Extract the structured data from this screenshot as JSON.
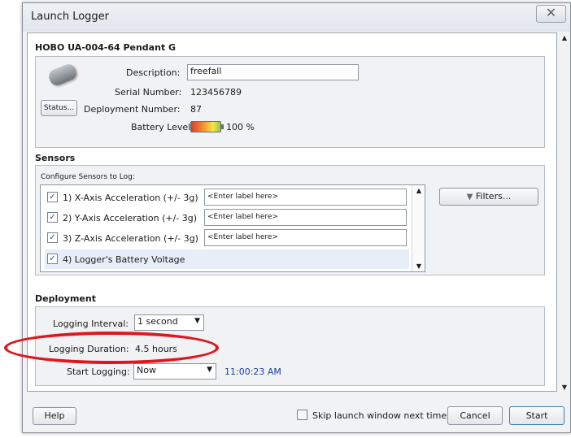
{
  "window": {
    "title": "Launch Logger",
    "close_glyph": "✕"
  },
  "device": {
    "name": "HOBO UA-004-64 Pendant G",
    "description_label": "Description:",
    "description_value": "freefall",
    "serial_label": "Serial Number:",
    "serial_value": "123456789",
    "deployment_label": "Deployment Number:",
    "deployment_value": "87",
    "battery_label": "Battery Level:",
    "battery_value": "100 %",
    "battery_level": 1.0,
    "status_button": "Status..."
  },
  "sensors": {
    "heading": "Sensors",
    "configure_label": "Configure Sensors to Log:",
    "filters_button": "Filters...",
    "items": [
      {
        "label": "1)  X-Axis Acceleration (+/- 3g)",
        "checked": true,
        "placeholder": "<Enter label here>"
      },
      {
        "label": "2)  Y-Axis Acceleration (+/- 3g)",
        "checked": true,
        "placeholder": "<Enter label here>"
      },
      {
        "label": "3)  Z-Axis Acceleration (+/- 3g)",
        "checked": true,
        "placeholder": "<Enter label here>"
      },
      {
        "label": "4)  Logger's Battery Voltage",
        "checked": true
      }
    ]
  },
  "deployment": {
    "heading": "Deployment",
    "interval_label": "Logging Interval:",
    "interval_value": "1 second",
    "duration_label": "Logging Duration:",
    "duration_value": "4.5 hours",
    "start_label": "Start Logging:",
    "start_value": "Now",
    "start_time": "11:00:23 AM"
  },
  "footer": {
    "help_button": "Help",
    "skip_label": "Skip launch window next time",
    "skip_checked": false,
    "cancel_button": "Cancel",
    "start_button": "Start"
  },
  "colors": {
    "annotation": "#e0161e",
    "time_text": "#1a3f9c"
  }
}
